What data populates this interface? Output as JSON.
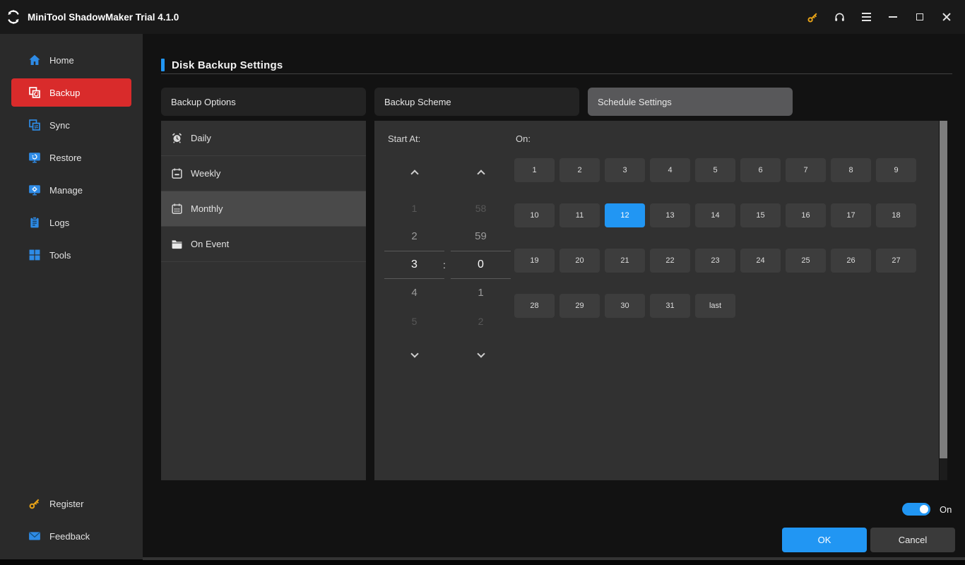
{
  "titlebar": {
    "title": "MiniTool ShadowMaker Trial 4.1.0"
  },
  "sidebar": {
    "items": [
      {
        "label": "Home",
        "icon": "home-icon",
        "active": false
      },
      {
        "label": "Backup",
        "icon": "backup-icon",
        "active": true
      },
      {
        "label": "Sync",
        "icon": "sync-icon",
        "active": false
      },
      {
        "label": "Restore",
        "icon": "restore-icon",
        "active": false
      },
      {
        "label": "Manage",
        "icon": "manage-icon",
        "active": false
      },
      {
        "label": "Logs",
        "icon": "logs-icon",
        "active": false
      },
      {
        "label": "Tools",
        "icon": "tools-icon",
        "active": false
      }
    ],
    "bottom_items": [
      {
        "label": "Register",
        "icon": "key-icon"
      },
      {
        "label": "Feedback",
        "icon": "envelope-icon"
      }
    ]
  },
  "header": {
    "title": "Disk Backup Settings"
  },
  "tabs": [
    {
      "label": "Backup Options",
      "active": false
    },
    {
      "label": "Backup Scheme",
      "active": false
    },
    {
      "label": "Schedule Settings",
      "active": true
    }
  ],
  "schedule_types": [
    {
      "label": "Daily",
      "icon": "alarm-clock-icon",
      "selected": false
    },
    {
      "label": "Weekly",
      "icon": "calendar-week-icon",
      "selected": false
    },
    {
      "label": "Monthly",
      "icon": "calendar-month-icon",
      "selected": true
    },
    {
      "label": "On Event",
      "icon": "folder-icon",
      "selected": false
    }
  ],
  "time_picker": {
    "label": "Start At:",
    "separator": ":",
    "hour_values": [
      "1",
      "2",
      "3",
      "4",
      "5"
    ],
    "minute_values": [
      "58",
      "59",
      "0",
      "1",
      "2"
    ],
    "selected_hour": "3",
    "selected_minute": "0"
  },
  "day_grid": {
    "label": "On:",
    "days": [
      "1",
      "2",
      "3",
      "4",
      "5",
      "6",
      "7",
      "8",
      "9",
      "10",
      "11",
      "12",
      "13",
      "14",
      "15",
      "16",
      "17",
      "18",
      "19",
      "20",
      "21",
      "22",
      "23",
      "24",
      "25",
      "26",
      "27",
      "28",
      "29",
      "30",
      "31",
      "last"
    ],
    "selected_day": "12"
  },
  "footer": {
    "toggle_state": "On",
    "ok_label": "OK",
    "cancel_label": "Cancel"
  },
  "colors": {
    "accent_blue": "#2196f3",
    "highlight_red": "#d92b2b",
    "gold_key": "#e8a317"
  }
}
